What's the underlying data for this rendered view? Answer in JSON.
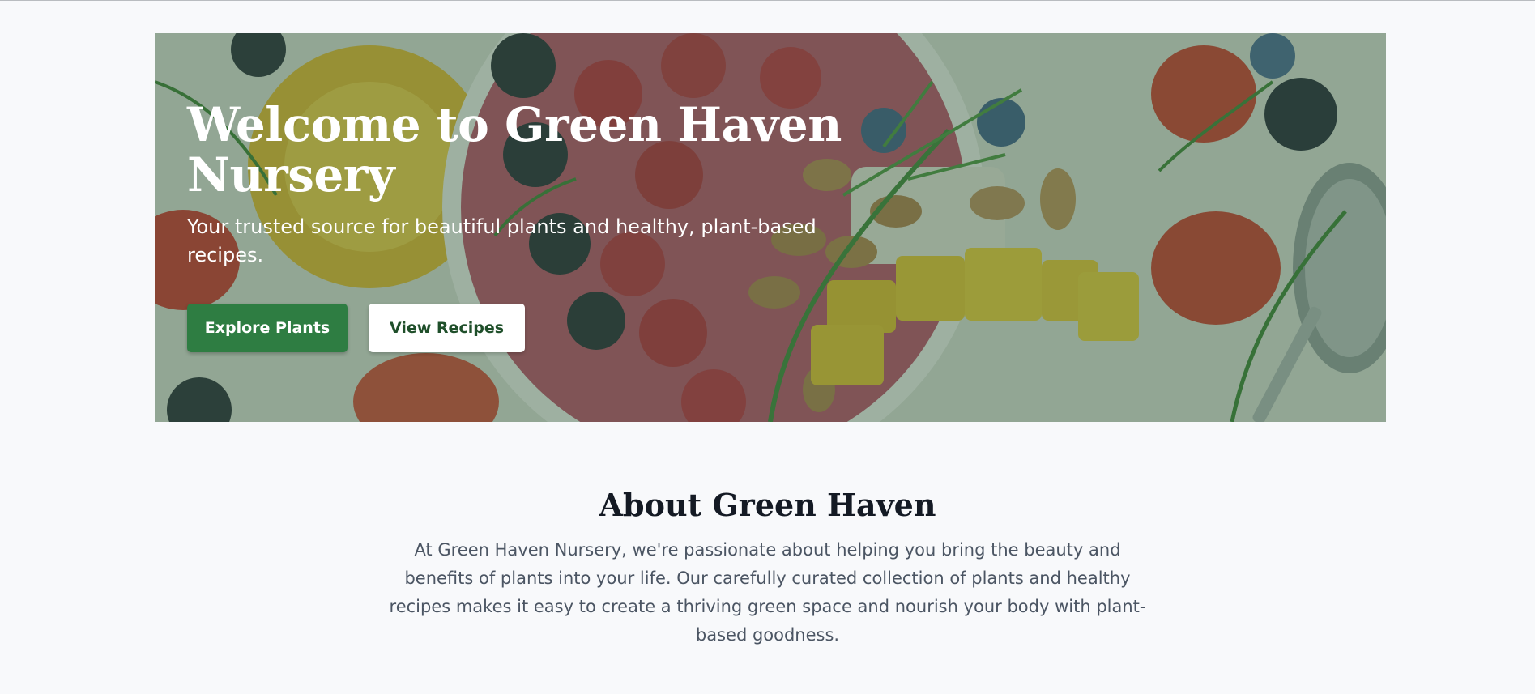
{
  "hero": {
    "title": "Welcome to Green Haven Nursery",
    "subtitle": "Your trusted source for beautiful plants and healthy, plant-based recipes.",
    "buttons": {
      "explore_plants": "Explore Plants",
      "view_recipes": "View Recipes"
    },
    "image_icon": "smoothie-bowl-image"
  },
  "about": {
    "title": "About Green Haven",
    "text": "At Green Haven Nursery, we're passionate about helping you bring the beauty and benefits of plants into your life. Our carefully curated collection of plants and healthy recipes makes it easy to create a thriving green space and nourish your body with plant-based goodness."
  },
  "colors": {
    "primary": "#2e7d42",
    "page_background": "#f8f9fb",
    "heading": "#141a24",
    "body_text": "#4b5563"
  }
}
